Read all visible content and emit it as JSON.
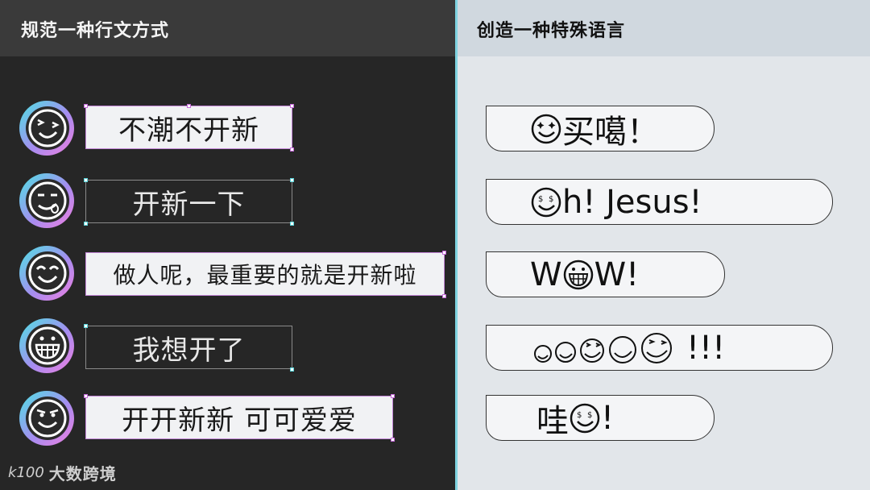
{
  "left": {
    "title": "规范一种行文方式",
    "rows": [
      {
        "text": "不潮不开新",
        "emoji": "wink-tongue-icon"
      },
      {
        "text": "开新一下",
        "emoji": "smirk-tongue-icon"
      },
      {
        "text": "做人呢，最重要的就是开新啦",
        "emoji": "happy-eyes-icon"
      },
      {
        "text": "我想开了",
        "emoji": "grin-teeth-icon"
      },
      {
        "text": "开开新新 可可爱爱",
        "emoji": "cheeky-smile-icon"
      }
    ]
  },
  "right": {
    "title": "创造一种特殊语言",
    "bubbles": [
      {
        "text": "买噶！",
        "emoji": "sparkle-eyes-icon"
      },
      {
        "pre": "",
        "text": "h! Jesus!",
        "emoji": "money-eyes-icon"
      },
      {
        "pre": "W",
        "text": "W!",
        "emoji": "grin-teeth-icon"
      },
      {
        "text": "!!!",
        "emoji": "wink-smiles-icon"
      },
      {
        "pre": "哇",
        "text": "!",
        "emoji": "money-eyes-icon"
      }
    ]
  },
  "watermark": {
    "logo": "k100",
    "text": "大数跨境"
  },
  "colors": {
    "left_bg": "#262626",
    "right_bg": "#e2e6ea",
    "accent_cyan": "#4de3e3",
    "accent_pink": "#f07fe0"
  }
}
